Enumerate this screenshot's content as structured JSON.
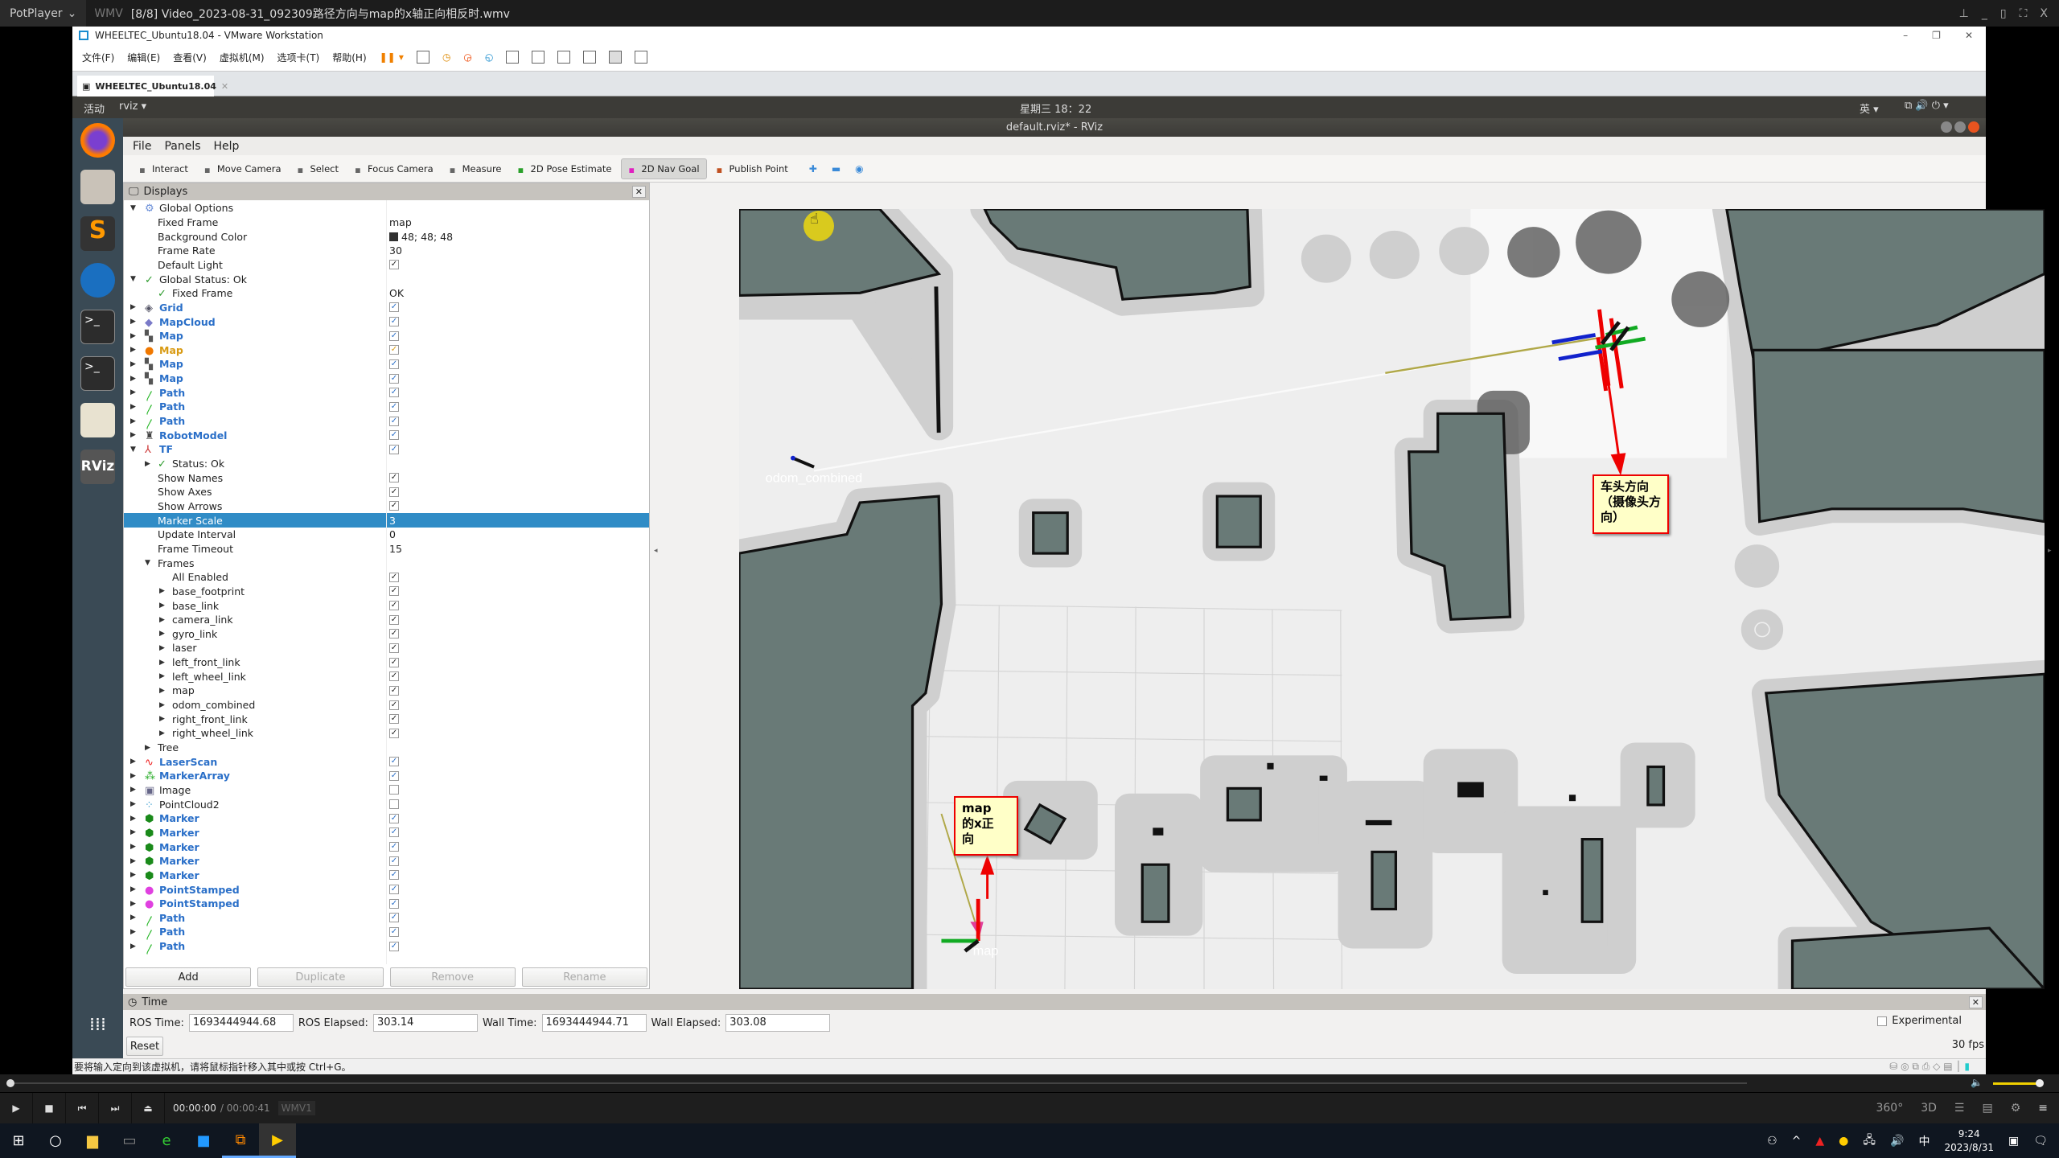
{
  "player": {
    "brand": "PotPlayer",
    "format": "WMV",
    "title": "[8/8] Video_2023-08-31_092309路径方向与map的x轴正向相反时.wmv",
    "time_current": "00:00:00",
    "time_total": "/ 00:00:41",
    "codec": "WMV1",
    "progress_percent": 0,
    "volume_percent": 90
  },
  "vmware": {
    "title": "WHEELTEC_Ubuntu18.04 - VMware Workstation",
    "menu": [
      "文件(F)",
      "编辑(E)",
      "查看(V)",
      "虚拟机(M)",
      "选项卡(T)",
      "帮助(H)"
    ],
    "tab": "WHEELTEC_Ubuntu18.04",
    "status": "要将输入定向到该虚拟机，请将鼠标指针移入其中或按 Ctrl+G。"
  },
  "ubuntu": {
    "activities": "活动",
    "app": "rviz ▾",
    "clock": "星期三 18：22",
    "ime": "英 ▾"
  },
  "rviz": {
    "window_title": "default.rviz* - RViz",
    "menu": [
      "File",
      "Panels",
      "Help"
    ],
    "tools": [
      {
        "label": "Interact",
        "icon": "hand-icon"
      },
      {
        "label": "Move Camera",
        "icon": "move-icon"
      },
      {
        "label": "Select",
        "icon": "select-icon"
      },
      {
        "label": "Focus Camera",
        "icon": "focus-icon"
      },
      {
        "label": "Measure",
        "icon": "ruler-icon"
      },
      {
        "label": "2D Pose Estimate",
        "icon": "pose-arrow-icon",
        "color": "#2aa02a"
      },
      {
        "label": "2D Nav Goal",
        "icon": "goal-arrow-icon",
        "color": "#e020c0",
        "active": true
      },
      {
        "label": "Publish Point",
        "icon": "pin-icon",
        "color": "#c05020"
      }
    ],
    "displays_title": "Displays",
    "tree": [
      {
        "l": "Global Options",
        "lv": 0,
        "e": "open",
        "i": "gear"
      },
      {
        "l": "Fixed Frame",
        "lv": 1,
        "v": "map"
      },
      {
        "l": "Background Color",
        "lv": 1,
        "v": "48; 48; 48",
        "sw": "#303030"
      },
      {
        "l": "Frame Rate",
        "lv": 1,
        "v": "30"
      },
      {
        "l": "Default Light",
        "lv": 1,
        "c": 1
      },
      {
        "l": "Global Status: Ok",
        "lv": 0,
        "e": "open",
        "i": "check"
      },
      {
        "l": "Fixed Frame",
        "lv": 1,
        "v": "OK",
        "i": "check"
      },
      {
        "l": "Grid",
        "lv": 0,
        "e": "closed",
        "i": "grid",
        "s": "blue",
        "c": 1
      },
      {
        "l": "MapCloud",
        "lv": 0,
        "e": "closed",
        "i": "diamond",
        "s": "blue",
        "c": 1
      },
      {
        "l": "Map",
        "lv": 0,
        "e": "closed",
        "i": "map",
        "s": "blue",
        "c": 1
      },
      {
        "l": "Map",
        "lv": 0,
        "e": "closed",
        "i": "warn",
        "s": "orange",
        "c": 1
      },
      {
        "l": "Map",
        "lv": 0,
        "e": "closed",
        "i": "map",
        "s": "blue",
        "c": 1
      },
      {
        "l": "Map",
        "lv": 0,
        "e": "closed",
        "i": "map",
        "s": "blue",
        "c": 1
      },
      {
        "l": "Path",
        "lv": 0,
        "e": "closed",
        "i": "path",
        "s": "blue",
        "c": 1
      },
      {
        "l": "Path",
        "lv": 0,
        "e": "closed",
        "i": "path",
        "s": "blue",
        "c": 1
      },
      {
        "l": "Path",
        "lv": 0,
        "e": "closed",
        "i": "path",
        "s": "blue",
        "c": 1
      },
      {
        "l": "RobotModel",
        "lv": 0,
        "e": "closed",
        "i": "robot",
        "s": "blue",
        "c": 1
      },
      {
        "l": "TF",
        "lv": 0,
        "e": "open",
        "i": "tf",
        "s": "blue",
        "c": 1
      },
      {
        "l": "Status: Ok",
        "lv": 1,
        "e": "closed",
        "i": "check"
      },
      {
        "l": "Show Names",
        "lv": 1,
        "c": 1
      },
      {
        "l": "Show Axes",
        "lv": 1,
        "c": 1
      },
      {
        "l": "Show Arrows",
        "lv": 1,
        "c": 1
      },
      {
        "l": "Marker Scale",
        "lv": 1,
        "v": "3",
        "sel": true
      },
      {
        "l": "Update Interval",
        "lv": 1,
        "v": "0"
      },
      {
        "l": "Frame Timeout",
        "lv": 1,
        "v": "15"
      },
      {
        "l": "Frames",
        "lv": 1,
        "e": "open"
      },
      {
        "l": "All Enabled",
        "lv": 2,
        "c": 1
      },
      {
        "l": "base_footprint",
        "lv": 2,
        "e": "closed",
        "c": 1
      },
      {
        "l": "base_link",
        "lv": 2,
        "e": "closed",
        "c": 1
      },
      {
        "l": "camera_link",
        "lv": 2,
        "e": "closed",
        "c": 1
      },
      {
        "l": "gyro_link",
        "lv": 2,
        "e": "closed",
        "c": 1
      },
      {
        "l": "laser",
        "lv": 2,
        "e": "closed",
        "c": 1
      },
      {
        "l": "left_front_link",
        "lv": 2,
        "e": "closed",
        "c": 1
      },
      {
        "l": "left_wheel_link",
        "lv": 2,
        "e": "closed",
        "c": 1
      },
      {
        "l": "map",
        "lv": 2,
        "e": "closed",
        "c": 1
      },
      {
        "l": "odom_combined",
        "lv": 2,
        "e": "closed",
        "c": 1
      },
      {
        "l": "right_front_link",
        "lv": 2,
        "e": "closed",
        "c": 1
      },
      {
        "l": "right_wheel_link",
        "lv": 2,
        "e": "closed",
        "c": 1
      },
      {
        "l": "Tree",
        "lv": 1,
        "e": "closed"
      },
      {
        "l": "LaserScan",
        "lv": 0,
        "e": "closed",
        "i": "laser",
        "s": "blue",
        "c": 1
      },
      {
        "l": "MarkerArray",
        "lv": 0,
        "e": "closed",
        "i": "markerarray",
        "s": "blue",
        "c": 1
      },
      {
        "l": "Image",
        "lv": 0,
        "e": "closed",
        "i": "image",
        "c": 0
      },
      {
        "l": "PointCloud2",
        "lv": 0,
        "e": "closed",
        "i": "cloud",
        "c": 0
      },
      {
        "l": "Marker",
        "lv": 0,
        "e": "closed",
        "i": "marker",
        "s": "blue",
        "c": 1
      },
      {
        "l": "Marker",
        "lv": 0,
        "e": "closed",
        "i": "marker",
        "s": "blue",
        "c": 1
      },
      {
        "l": "Marker",
        "lv": 0,
        "e": "closed",
        "i": "marker",
        "s": "blue",
        "c": 1
      },
      {
        "l": "Marker",
        "lv": 0,
        "e": "closed",
        "i": "marker",
        "s": "blue",
        "c": 1
      },
      {
        "l": "Marker",
        "lv": 0,
        "e": "closed",
        "i": "marker",
        "s": "blue",
        "c": 1
      },
      {
        "l": "PointStamped",
        "lv": 0,
        "e": "closed",
        "i": "point",
        "s": "blue",
        "c": 1
      },
      {
        "l": "PointStamped",
        "lv": 0,
        "e": "closed",
        "i": "point",
        "s": "blue",
        "c": 1
      },
      {
        "l": "Path",
        "lv": 0,
        "e": "closed",
        "i": "path",
        "s": "blue",
        "c": 1
      },
      {
        "l": "Path",
        "lv": 0,
        "e": "closed",
        "i": "path",
        "s": "blue",
        "c": 1
      },
      {
        "l": "Path",
        "lv": 0,
        "e": "closed",
        "i": "path",
        "s": "blue",
        "c": 1
      }
    ],
    "buttons": {
      "add": "Add",
      "duplicate": "Duplicate",
      "remove": "Remove",
      "rename": "Rename"
    },
    "scene": {
      "frame_odom": "odom_combined",
      "frame_map": "map",
      "note_heading": "车头方向（摄像头方向）",
      "note_map_x_line1": "map",
      "note_map_x_line2": "的x正",
      "note_map_x_line3": "向"
    },
    "time": {
      "title": "Time",
      "ros_time_label": "ROS Time:",
      "ros_time": "1693444944.68",
      "ros_elapsed_label": "ROS Elapsed:",
      "ros_elapsed": "303.14",
      "wall_time_label": "Wall Time:",
      "wall_time": "1693444944.71",
      "wall_elapsed_label": "Wall Elapsed:",
      "wall_elapsed": "303.08",
      "reset": "Reset",
      "experimental": "Experimental",
      "fps": "30 fps"
    }
  },
  "taskbar": {
    "time": "9:24",
    "date": "2023/8/31",
    "ime": "中"
  }
}
